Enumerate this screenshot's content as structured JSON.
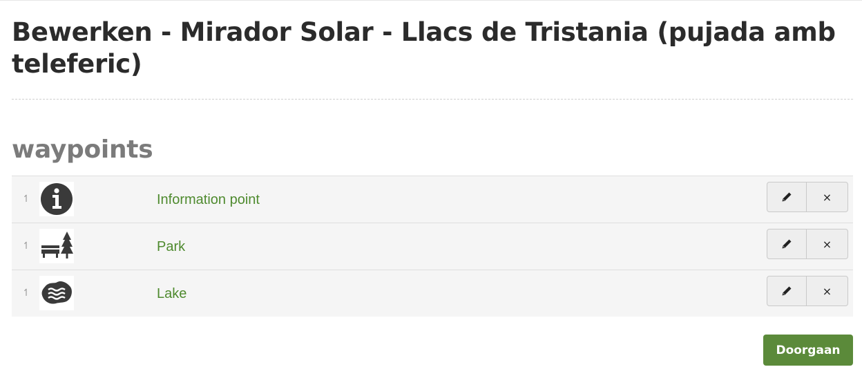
{
  "page": {
    "title": "Bewerken - Mirador Solar - Llacs de Tristania (pujada amb teleferic)"
  },
  "section": {
    "heading": "waypoints"
  },
  "waypoints": [
    {
      "name": "Information point",
      "icon": "information-icon"
    },
    {
      "name": "Park",
      "icon": "park-icon"
    },
    {
      "name": "Lake",
      "icon": "lake-icon"
    }
  ],
  "actions": {
    "edit_icon": "pencil-icon",
    "delete_icon": "close-icon",
    "delete_symbol": "×",
    "drag_symbol": "↿"
  },
  "footer": {
    "continue_label": "Doorgaan"
  },
  "colors": {
    "link_green": "#4e8a2e",
    "primary_button": "#5b8a3a",
    "heading_gray": "#7b7b7b"
  }
}
